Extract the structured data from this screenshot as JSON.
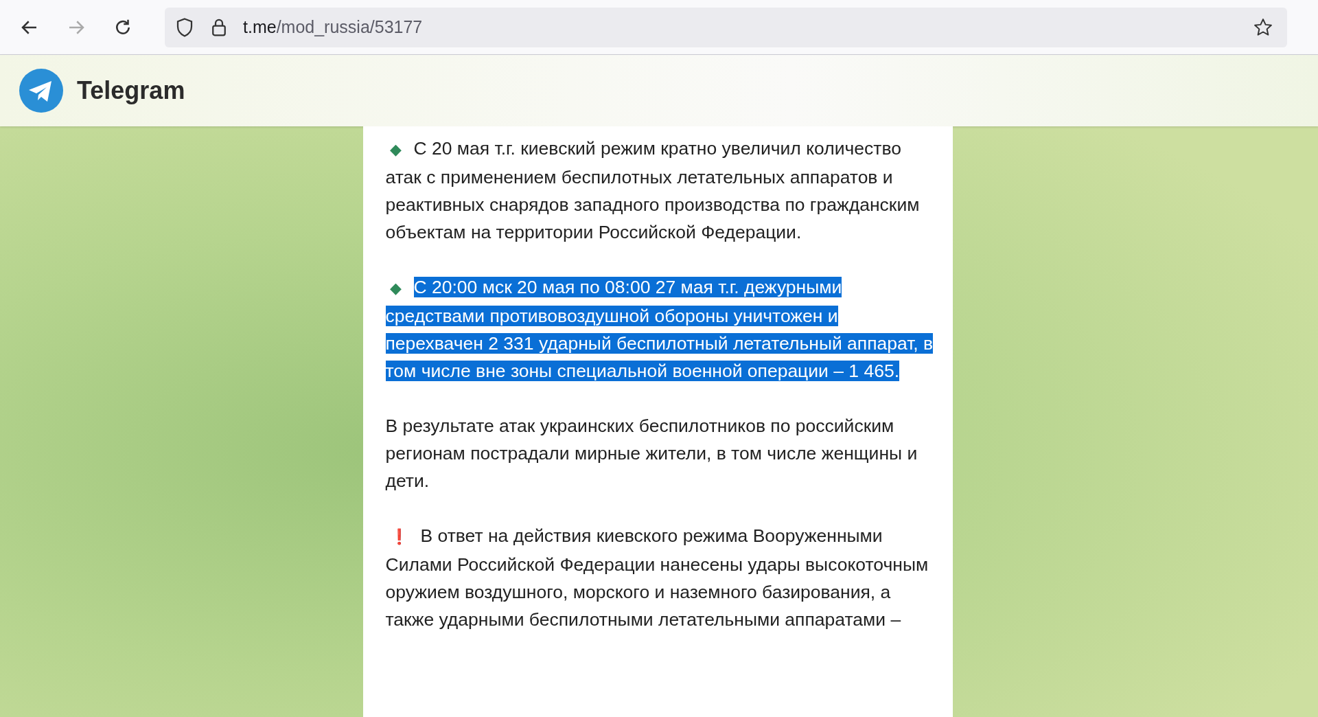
{
  "browser": {
    "url_host": "t.me",
    "url_path": "/mod_russia/53177"
  },
  "header": {
    "title": "Telegram"
  },
  "message": {
    "paragraphs": [
      {
        "marker": "◆",
        "text": "С 20 мая т.г. киевский режим кратно увеличил количество атак с применением беспилотных летательных аппаратов и реактивных снарядов западного производства по гражданским объектам на территории Российской Федерации.",
        "selected": false
      },
      {
        "marker": "◆",
        "text": "С 20:00 мск 20 мая по 08:00 27 мая т.г. дежурными средствами противовоздушной обороны уничтожен и перехвачен 2 331 ударный беспилотный летательный аппарат, в том числе вне зоны специальной военной операции – 1 465.",
        "selected": true
      },
      {
        "text": "В результате атак украинских беспилотников по российским регионам пострадали мирные жители, в том числе женщины и дети.",
        "selected": false
      },
      {
        "marker": "❗",
        "text": "В ответ на действия киевского режима Вооруженными Силами Российской Федерации нанесены удары высокоточным оружием воздушного, морского и наземного базирования, а также ударными беспилотными летательными аппаратами –",
        "selected": false
      }
    ]
  }
}
